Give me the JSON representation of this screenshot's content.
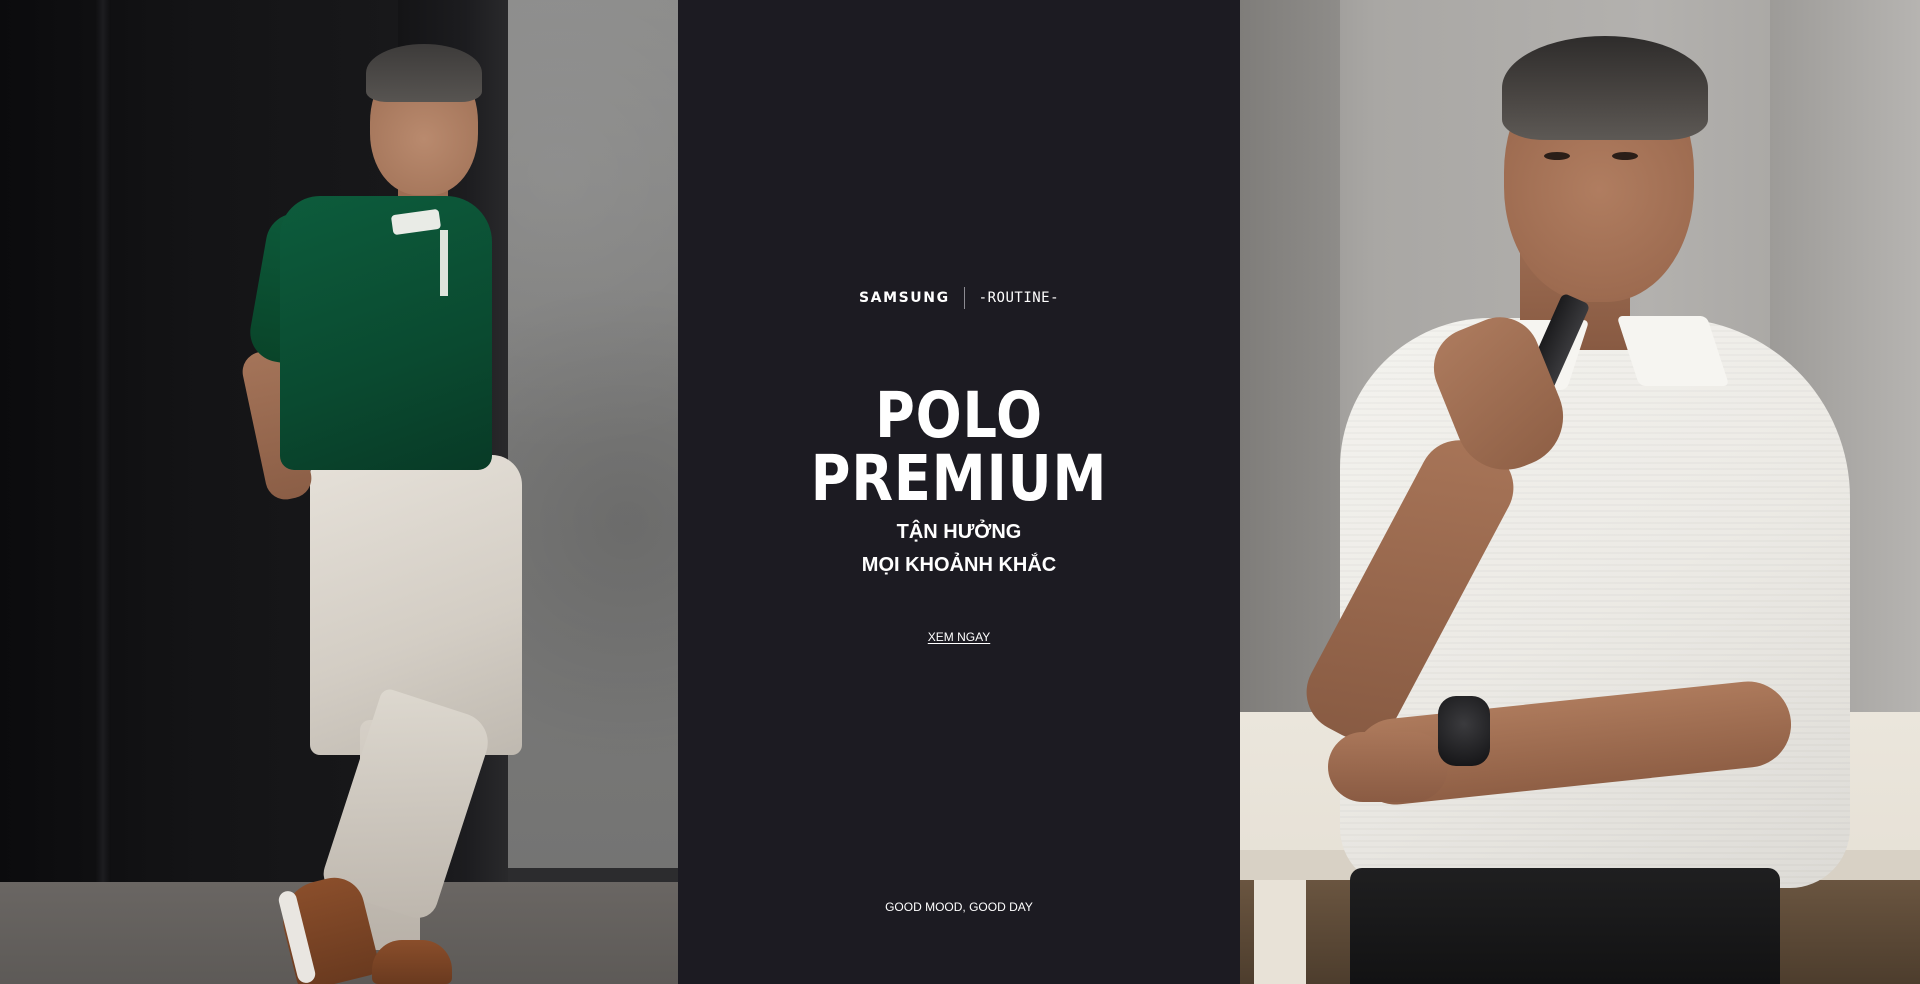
{
  "brand": {
    "samsung": "SAMSUNG",
    "partner": "-ROUTINE-"
  },
  "headline": "POLO PREMIUM",
  "subhead": {
    "line1": "TẬN HƯỞNG",
    "line2": "MỌI KHOẢNH KHẮC"
  },
  "cta": "XEM NGAY",
  "tagline": "GOOD MOOD, GOOD DAY",
  "colors": {
    "panel_background": "#1c1b22",
    "text": "#ffffff",
    "polo_green": "#0a4a30",
    "polo_white": "#f4f3ef"
  }
}
